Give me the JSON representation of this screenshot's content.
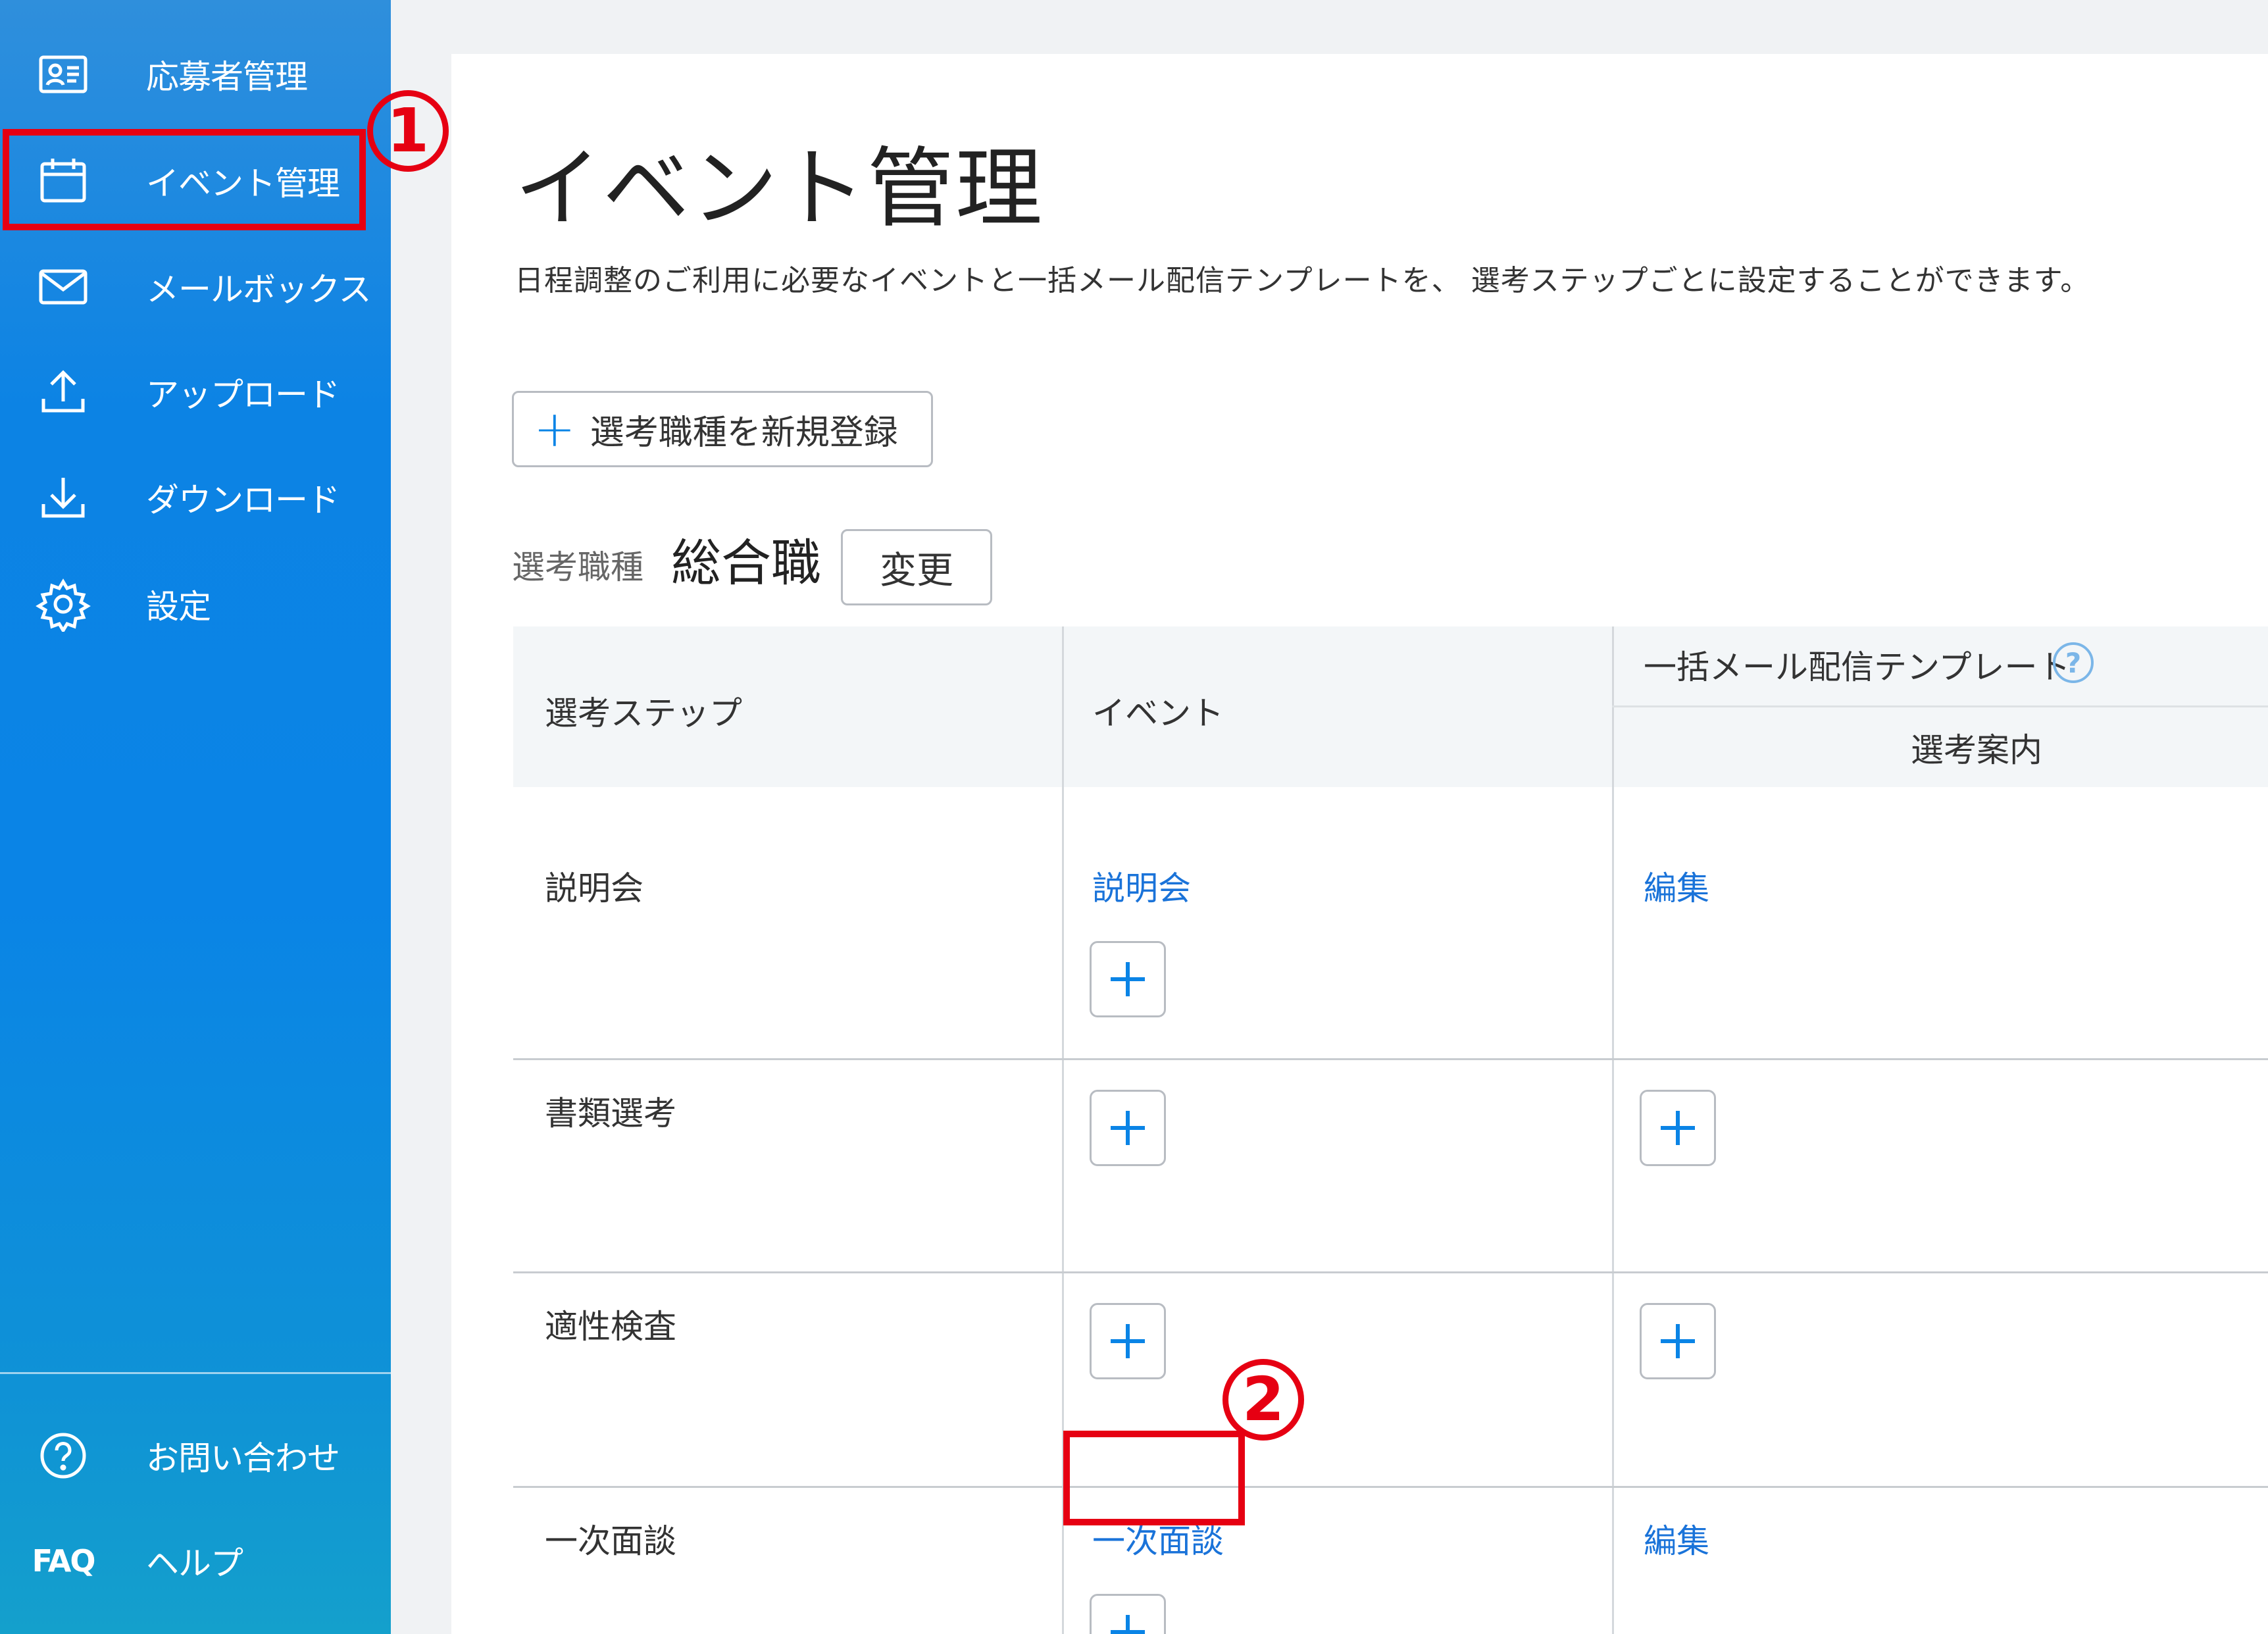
{
  "sidebar": {
    "items": [
      {
        "label": "応募者管理",
        "icon": "id-card-icon"
      },
      {
        "label": "イベント管理",
        "icon": "calendar-icon"
      },
      {
        "label": "メールボックス",
        "icon": "mail-icon"
      },
      {
        "label": "アップロード",
        "icon": "upload-icon"
      },
      {
        "label": "ダウンロード",
        "icon": "download-icon"
      },
      {
        "label": "設定",
        "icon": "gear-icon"
      }
    ],
    "footer": [
      {
        "label": "お問い合わせ",
        "icon": "question-circle-icon"
      },
      {
        "label": "ヘルプ",
        "icon_text": "FAQ"
      }
    ]
  },
  "annotations": {
    "one": "1",
    "two": "2"
  },
  "main": {
    "title": "イベント管理",
    "description": "日程調整のご利用に必要なイベントと一括メール配信テンプレートを、 選考ステップごとに設定することができます。",
    "new_button": {
      "plus": "+",
      "label": "選考職種を新規登録"
    },
    "job_type_label": "選考職種",
    "job_type_value": "総合職",
    "change_button": "変更"
  },
  "table": {
    "headers": {
      "step": "選考ステップ",
      "event": "イベント",
      "template_group": "一括メール配信テンプレート",
      "template_help": "?",
      "template_sub": "選考案内"
    },
    "rows": [
      {
        "step": "説明会",
        "event_link": "説明会",
        "template_link": "編集"
      },
      {
        "step": "書類選考",
        "event_link": "",
        "template_link": ""
      },
      {
        "step": "適性検査",
        "event_link": "",
        "template_link": ""
      },
      {
        "step": "一次面談",
        "event_link": "一次面談",
        "template_link": "編集"
      }
    ]
  },
  "colors": {
    "accent": "#0a84e6",
    "link": "#1a73d9",
    "annotation": "#e60012",
    "header_bg": "#f3f6f8"
  }
}
